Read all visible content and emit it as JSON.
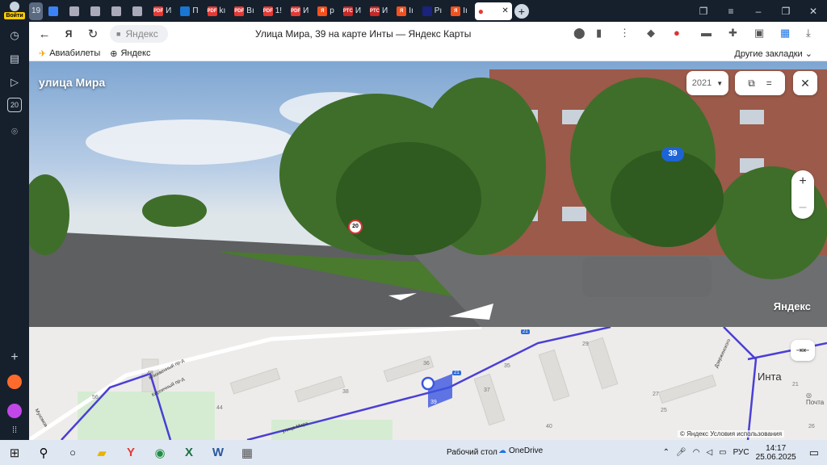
{
  "profile": {
    "label": "Войти"
  },
  "sidebar": {
    "badge": "20"
  },
  "tabs": [
    {
      "label": "19",
      "fav": "#5a6a80",
      "fav_text": ""
    },
    {
      "label": "",
      "fav": "#3b82f6",
      "fav_text": ""
    },
    {
      "label": "",
      "fav": "#aab",
      "fav_text": ""
    },
    {
      "label": "",
      "fav": "#aab",
      "fav_text": ""
    },
    {
      "label": "",
      "fav": "#aab",
      "fav_text": ""
    },
    {
      "label": "",
      "fav": "#aab",
      "fav_text": ""
    },
    {
      "label": "И",
      "fav": "#e53935",
      "fav_text": "PDF"
    },
    {
      "label": "П",
      "fav": "#1976d2",
      "fav_text": ""
    },
    {
      "label": "kı",
      "fav": "#e53935",
      "fav_text": "PDF"
    },
    {
      "label": "Вı",
      "fav": "#e53935",
      "fav_text": "PDF"
    },
    {
      "label": "1!",
      "fav": "#e53935",
      "fav_text": "PDF"
    },
    {
      "label": "И",
      "fav": "#e53935",
      "fav_text": "PDF"
    },
    {
      "label": "р",
      "fav": "#f4511e",
      "fav_text": "Я"
    },
    {
      "label": "И",
      "fav": "#c62828",
      "fav_text": "РТС"
    },
    {
      "label": "И",
      "fav": "#c62828",
      "fav_text": "РТС"
    },
    {
      "label": "Iı",
      "fav": "#f4511e",
      "fav_text": "Я"
    },
    {
      "label": "Рı",
      "fav": "#1a237e",
      "fav_text": ""
    },
    {
      "label": "Iı",
      "fav": "#f4511e",
      "fav_text": "Я"
    }
  ],
  "active_tab": {
    "label": "",
    "close": "✕"
  },
  "address": {
    "pill": "Яндекс",
    "title": "Улица Мира, 39 на карте Инты — Яндекс Карты"
  },
  "bookmarks": {
    "items": [
      "Авиабилеты",
      "Яндекс"
    ],
    "other": "Другие закладки"
  },
  "panorama": {
    "street": "улица Мира",
    "year": "2021",
    "house": "39",
    "watermark": "Яндекс",
    "sign_speed": "20"
  },
  "map": {
    "city": "Инта",
    "attribution": "© Яндекс  Условия использования",
    "streets": [
      "улица Мира",
      "Кирпичный пр-д",
      "Клюквенный пр-д",
      "Дзержинского",
      "Мухомов"
    ],
    "numbers": [
      "36",
      "35",
      "37",
      "38",
      "44",
      "56",
      "48",
      "29",
      "27",
      "25",
      "21",
      "39",
      "26",
      "40",
      "Почта"
    ],
    "road_badges": [
      "21",
      "21"
    ]
  },
  "taskbar": {
    "desktop": "Рабочий стол",
    "onedrive": "OneDrive",
    "lang": "РУС",
    "time": "14:17",
    "date": "25.06.2025"
  }
}
